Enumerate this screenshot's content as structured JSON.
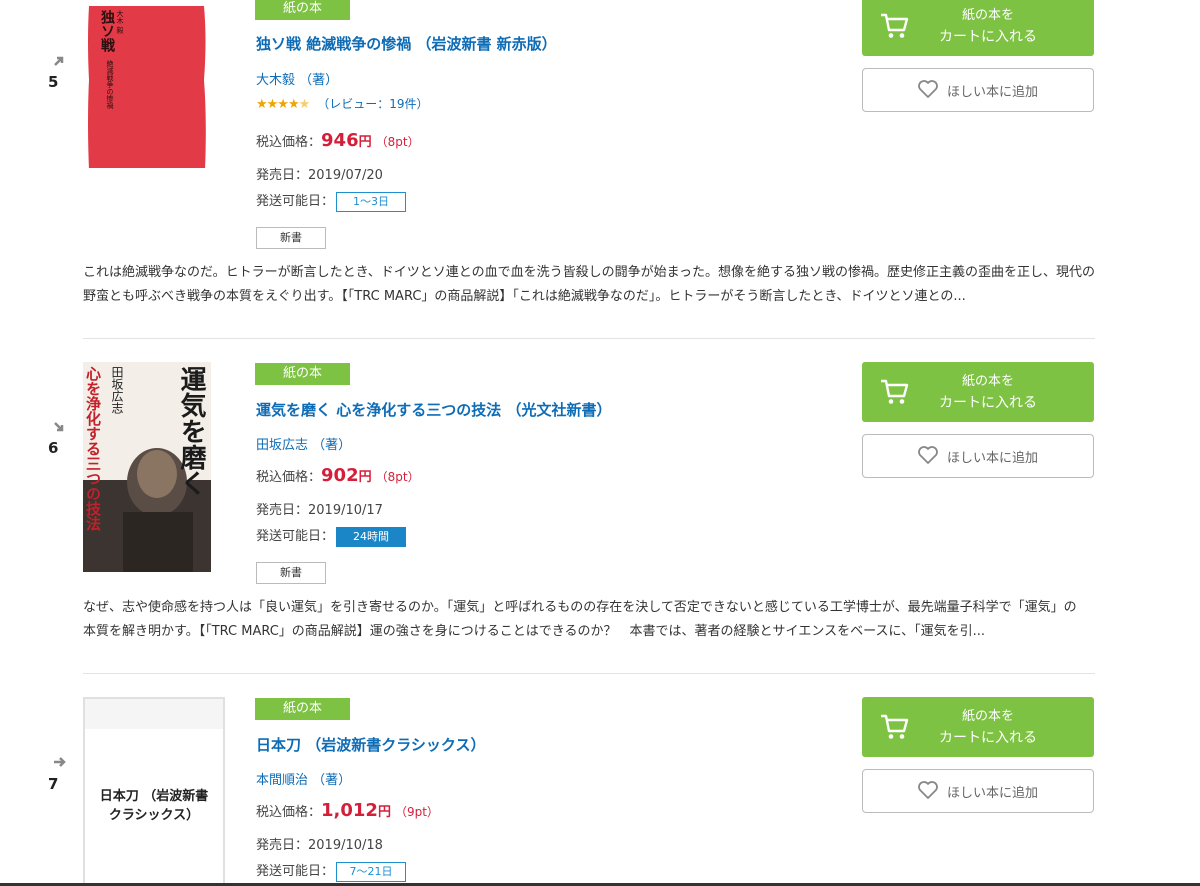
{
  "colors": {
    "green": "#7dc243",
    "link": "#0e6cb6",
    "price": "#d51f3a",
    "ship_blue": "#1a86c8"
  },
  "entries": [
    {
      "rank": "5",
      "rank_icon": "arrow-up-right-icon",
      "badge": "紙の本",
      "title": "独ソ戦 絶滅戦争の惨禍 （岩波新書 新赤版）",
      "author": "大木毅 （著）",
      "rating_stars": 4.5,
      "rating_text": "（レビュー：19件）",
      "price_label": "税込価格：",
      "price": "946",
      "yen": "円",
      "points": "（8pt）",
      "release": "発売日：2019/07/20",
      "ship_label": "発送可能日：",
      "ship_value": "1〜3日",
      "genre": "新書",
      "desc_line1": "これは絶滅戦争なのだ。ヒトラーが断言したとき、ドイツとソ連との血で血を洗う皆殺しの闘争が始まった。想像を絶する独ソ戦の惨禍。歴史修正主義の歪曲を正し、現代の",
      "desc_line2": "野蛮とも呼ぶべき戦争の本質をえぐり出す。【「TRC MARC」の商品解説】「これは絶滅戦争なのだ」。ヒトラーがそう断言したとき、ドイツとソ連との...",
      "cart_line1": "紙の本を",
      "cart_line2": "カートに入れる",
      "wish": "ほしい本に追加",
      "cover_title": "独ソ戦",
      "cover_sub": "絶滅戦争の惨禍",
      "cover_author": "大木 毅"
    },
    {
      "rank": "6",
      "rank_icon": "arrow-down-right-icon",
      "badge": "紙の本",
      "title": "運気を磨く 心を浄化する三つの技法 （光文社新書）",
      "author": "田坂広志 （著）",
      "price_label": "税込価格：",
      "price": "902",
      "yen": "円",
      "points": "（8pt）",
      "release": "発売日：2019/10/17",
      "ship_label": "発送可能日：",
      "ship_value": "24時間",
      "genre": "新書",
      "desc_line1": "なぜ、志や使命感を持つ人は「良い運気」を引き寄せるのか。「運気」と呼ばれるものの存在を決して否定できないと感じている工学博士が、最先端量子科学で「運気」の",
      "desc_line2": "本質を解き明かす。【「TRC MARC」の商品解説】運の強さを身につけることはできるのか？　本書では、著者の経験とサイエンスをベースに、「運気を引...",
      "cart_line1": "紙の本を",
      "cart_line2": "カートに入れる",
      "wish": "ほしい本に追加",
      "cover_title": "運気を磨く",
      "cover_sub": "心を浄化する三つの技法",
      "cover_author": "田坂広志"
    },
    {
      "rank": "7",
      "rank_icon": "arrow-right-icon",
      "badge": "紙の本",
      "title": "日本刀 （岩波新書クラシックス）",
      "author": "本間順治 （著）",
      "price_label": "税込価格：",
      "price": "1,012",
      "yen": "円",
      "points": "（9pt）",
      "release": "発売日：2019/10/18",
      "ship_label": "発送可能日：",
      "ship_value": "7〜21日",
      "cart_line1": "紙の本を",
      "cart_line2": "カートに入れる",
      "wish": "ほしい本に追加",
      "cover_line1": "日本刀 （岩波新書",
      "cover_line2": "クラシックス）"
    }
  ]
}
